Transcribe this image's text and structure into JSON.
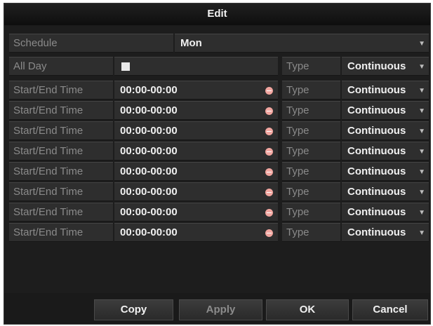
{
  "dialog": {
    "title": "Edit"
  },
  "schedule": {
    "label": "Schedule",
    "value": "Mon"
  },
  "all_day": {
    "label": "All Day",
    "checked": false,
    "type_label": "Type",
    "type_value": "Continuous"
  },
  "time_rows": [
    {
      "label": "Start/End Time",
      "time": "00:00-00:00",
      "type_label": "Type",
      "type_value": "Continuous"
    },
    {
      "label": "Start/End Time",
      "time": "00:00-00:00",
      "type_label": "Type",
      "type_value": "Continuous"
    },
    {
      "label": "Start/End Time",
      "time": "00:00-00:00",
      "type_label": "Type",
      "type_value": "Continuous"
    },
    {
      "label": "Start/End Time",
      "time": "00:00-00:00",
      "type_label": "Type",
      "type_value": "Continuous"
    },
    {
      "label": "Start/End Time",
      "time": "00:00-00:00",
      "type_label": "Type",
      "type_value": "Continuous"
    },
    {
      "label": "Start/End Time",
      "time": "00:00-00:00",
      "type_label": "Type",
      "type_value": "Continuous"
    },
    {
      "label": "Start/End Time",
      "time": "00:00-00:00",
      "type_label": "Type",
      "type_value": "Continuous"
    },
    {
      "label": "Start/End Time",
      "time": "00:00-00:00",
      "type_label": "Type",
      "type_value": "Continuous"
    }
  ],
  "buttons": {
    "copy": "Copy",
    "apply": "Apply",
    "ok": "OK",
    "cancel": "Cancel"
  },
  "icons": {
    "dropdown": "chevron-down-icon",
    "clock": "clock-icon",
    "checkbox": "checkbox-icon"
  },
  "colors": {
    "background": "#1d1d1d",
    "cell": "#2e2e2e",
    "label": "#8a8a8a",
    "value": "#f0f0f0",
    "clock": "#f2a6a0"
  }
}
